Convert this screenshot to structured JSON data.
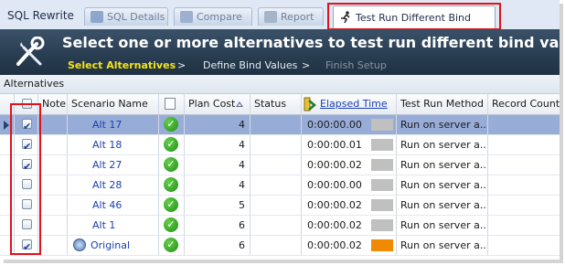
{
  "app_title": "SQL Rewrite",
  "tabs": [
    {
      "label": "SQL Details"
    },
    {
      "label": "Compare"
    },
    {
      "label": "Report"
    },
    {
      "label": "Test Run Different Bind Values"
    }
  ],
  "banner": {
    "title": "Select one or more alternatives to test run different bind values",
    "steps": [
      {
        "label": "Select Alternatives",
        "state": "active"
      },
      {
        "label": "Define Bind Values",
        "state": "normal"
      },
      {
        "label": "Finish Setup",
        "state": "disabled"
      }
    ],
    "separator": ">"
  },
  "group_header": "Alternatives",
  "columns": {
    "note": "Note",
    "scenario_name": "Scenario Name",
    "plan_cost": "Plan Cost",
    "status": "Status",
    "elapsed_time": "Elapsed Time",
    "test_run_method": "Test Run Method",
    "record_count": "Record Count"
  },
  "rows": [
    {
      "checked": true,
      "name": "Alt 17",
      "plan_cost": "4",
      "elapsed": "0:00:00.00",
      "bar_color": "#c0c0c0",
      "method": "Run on server a...",
      "selected": true
    },
    {
      "checked": true,
      "name": "Alt 18",
      "plan_cost": "4",
      "elapsed": "0:00:00.01",
      "bar_color": "#c0c0c0",
      "method": "Run on server a...",
      "selected": false
    },
    {
      "checked": true,
      "name": "Alt 27",
      "plan_cost": "4",
      "elapsed": "0:00:00.02",
      "bar_color": "#c0c0c0",
      "method": "Run on server a...",
      "selected": false
    },
    {
      "checked": false,
      "name": "Alt 28",
      "plan_cost": "4",
      "elapsed": "0:00:00.00",
      "bar_color": "#c0c0c0",
      "method": "Run on server a...",
      "selected": false
    },
    {
      "checked": false,
      "name": "Alt 46",
      "plan_cost": "5",
      "elapsed": "0:00:00.02",
      "bar_color": "#c0c0c0",
      "method": "Run on server a...",
      "selected": false
    },
    {
      "checked": false,
      "name": "Alt 1",
      "plan_cost": "6",
      "elapsed": "0:00:00.02",
      "bar_color": "#c0c0c0",
      "method": "Run on server a...",
      "selected": false
    },
    {
      "checked": true,
      "name": "Original",
      "plan_cost": "6",
      "elapsed": "0:00:00.02",
      "bar_color": "#f28a00",
      "method": "Run on server a...",
      "selected": false,
      "is_original": true
    }
  ],
  "colors": {
    "highlight": "#e0131a",
    "banner": "#2a3e52",
    "selected_row": "#98acd8",
    "ok_icon": "#1f8e16",
    "link": "#1a3fb0"
  },
  "icons": {
    "tools": "wrench-screwdriver-icon",
    "status_ok": "check-circle-icon"
  }
}
